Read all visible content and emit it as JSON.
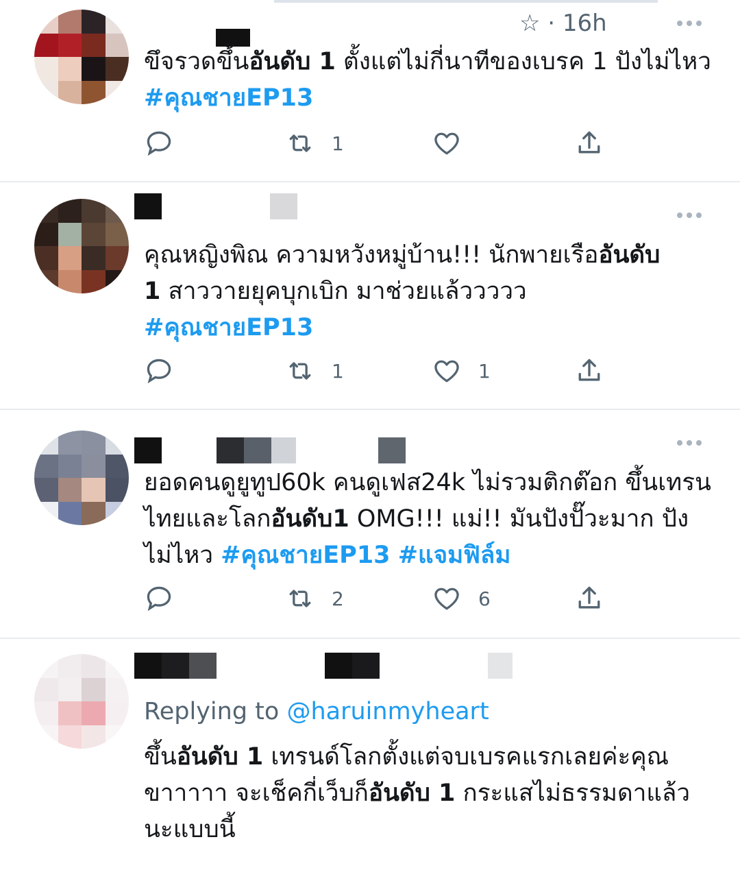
{
  "tweets": [
    {
      "time": "16h",
      "star": "☆",
      "dot": "·",
      "text": [
        {
          "t": "ขึจรวดขึ้น"
        },
        {
          "t": "อันดับ 1",
          "s": "b"
        },
        {
          "t": " ตั้งแต่ไม่กี่นาทีของเบรค 1 ปังไม่ไหว "
        },
        {
          "t": "#คุณชายEP13",
          "s": "tag"
        }
      ],
      "replies": "",
      "retweets": "1",
      "likes": ""
    },
    {
      "text": [
        {
          "t": "คุณหญิงพิณ ความหวังหมู่บ้าน!!! นักพายเรือ"
        },
        {
          "t": "อันดับ\n1",
          "s": "b"
        },
        {
          "t": " สาววายยุคบุกเบิก มาช่วยแล้ววววว\n"
        },
        {
          "t": "#คุณชายEP13",
          "s": "tag"
        }
      ],
      "replies": "",
      "retweets": "1",
      "likes": "1"
    },
    {
      "text": [
        {
          "t": "ยอดคนดูยูทูป60k คนดูเฟส24k ไม่รวมติกต๊อก ขึ้นเทรนไทยและโลก"
        },
        {
          "t": "อันดับ1",
          "s": "b"
        },
        {
          "t": " OMG!!! แม่!! มันปังปั๊วะมาก ปังไม่ไหว "
        },
        {
          "t": "#คุณชายEP13",
          "s": "tag"
        },
        {
          "t": " "
        },
        {
          "t": "#แจมฟิล์ม",
          "s": "tag"
        }
      ],
      "replies": "",
      "retweets": "2",
      "likes": "6"
    },
    {
      "replying_label": "Replying to",
      "replying_handle": "@haruinmyheart",
      "text": [
        {
          "t": "ขึ้น"
        },
        {
          "t": "อันดับ 1",
          "s": "b"
        },
        {
          "t": " เทรนด์โลกตั้งแต่จบเบรคแรกเลยค่ะคุณขาาาาา จะเช็คกี่เว็บก็"
        },
        {
          "t": "อันดับ 1",
          "s": "b"
        },
        {
          "t": " กระแสไม่ธรรมดาแล้วนะแบบนี้"
        }
      ]
    }
  ],
  "icons": {
    "reply": "reply-icon",
    "retweet": "retweet-icon",
    "like": "heart-icon",
    "share": "share-icon",
    "more": "more-icon"
  },
  "colors": {
    "hashtag": "#1d9bf0",
    "muted": "#536471",
    "divider": "#e6ecf0"
  }
}
